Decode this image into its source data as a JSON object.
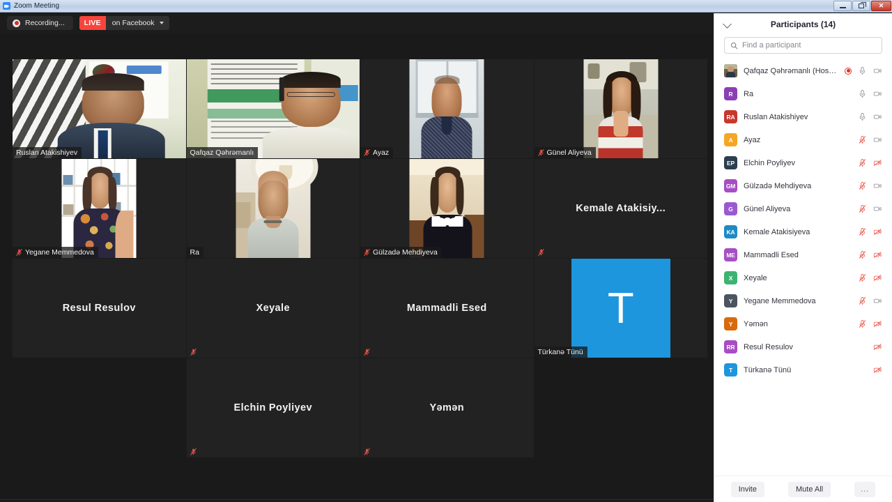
{
  "window": {
    "title": "Zoom Meeting",
    "app_icon": "zoom-camera-icon",
    "minimize_label": "Minimize",
    "restore_label": "Restore",
    "close_label": "Close"
  },
  "toolbar": {
    "recording_label": "Recording...",
    "recording_icon": "record-dot-icon",
    "live_tag": "LIVE",
    "live_destination": "on Facebook",
    "live_caret_icon": "chevron-down-icon"
  },
  "grid": {
    "active_speaker_color": "#c7e035",
    "tile_bg": "#222222",
    "tiles": [
      {
        "name": "Ruslan Atakishiyev",
        "mode": "video",
        "muted": false,
        "active": false,
        "name_position": "bottom-left",
        "feed": "blinds-office",
        "row": 0,
        "col": 0
      },
      {
        "name": "Qafqaz Qəhrəmanlı",
        "mode": "video",
        "muted": false,
        "active": true,
        "name_position": "bottom-left",
        "feed": "banner-headset",
        "row": 0,
        "col": 1
      },
      {
        "name": "Ayaz",
        "mode": "video",
        "muted": true,
        "active": false,
        "name_position": "bottom-left",
        "feed": "window-man",
        "row": 0,
        "col": 2
      },
      {
        "name": "Günel Aliyeva",
        "mode": "video",
        "muted": true,
        "active": false,
        "name_position": "bottom-left",
        "feed": "kitchen-woman",
        "row": 0,
        "col": 3
      },
      {
        "name": "Yegane Memmedova",
        "mode": "video",
        "muted": true,
        "active": false,
        "name_position": "bottom-left",
        "feed": "bookshelf-woman",
        "row": 1,
        "col": 0
      },
      {
        "name": "Ra",
        "mode": "video",
        "muted": false,
        "active": false,
        "name_position": "bottom-left",
        "feed": "ceiling-man",
        "row": 1,
        "col": 1
      },
      {
        "name": "Gülzadə Mehdiyeva",
        "mode": "video",
        "muted": true,
        "active": false,
        "name_position": "bottom-left",
        "feed": "room-woman",
        "row": 1,
        "col": 2
      },
      {
        "name": "Kemale Atakisiy...",
        "mode": "name",
        "muted": true,
        "active": false,
        "name_position": "center",
        "row": 1,
        "col": 3
      },
      {
        "name": "Resul Resulov",
        "mode": "name",
        "muted": false,
        "active": false,
        "name_position": "center",
        "row": 2,
        "col": 0
      },
      {
        "name": "Xeyale",
        "mode": "name",
        "muted": true,
        "active": false,
        "name_position": "center",
        "row": 2,
        "col": 1
      },
      {
        "name": "Mammadli Esed",
        "mode": "name",
        "muted": true,
        "active": false,
        "name_position": "center",
        "row": 2,
        "col": 2
      },
      {
        "name": "Türkanə Tünü",
        "mode": "avatar",
        "avatar_letter": "T",
        "avatar_color": "#1d96dd",
        "muted": false,
        "active": false,
        "name_position": "bottom-left",
        "row": 2,
        "col": 3
      },
      {
        "name": "Elchin Poyliyev",
        "mode": "name",
        "muted": true,
        "active": false,
        "name_position": "center",
        "row": 3,
        "col": 1
      },
      {
        "name": "Yəmən",
        "mode": "name",
        "muted": true,
        "active": false,
        "name_position": "center",
        "row": 3,
        "col": 2
      }
    ]
  },
  "panel": {
    "collapse_icon": "chevron-down-icon",
    "title": "Participants (14)",
    "search": {
      "icon": "search-icon",
      "placeholder": "Find a participant",
      "value": ""
    },
    "participants": [
      {
        "name": "Qafqaz Qəhrəmanlı (Host, me)",
        "initials": "",
        "avatar_type": "photo",
        "color": "#4a4236",
        "recording": true,
        "mic": "on",
        "video": "on"
      },
      {
        "name": "Ra",
        "initials": "R",
        "avatar_type": "initials",
        "color": "#8b3fb5",
        "recording": false,
        "mic": "on",
        "video": "on"
      },
      {
        "name": "Ruslan Atakishiyev",
        "initials": "RA",
        "avatar_type": "initials",
        "color": "#c8372d",
        "recording": false,
        "mic": "on",
        "video": "on"
      },
      {
        "name": "Ayaz",
        "initials": "A",
        "avatar_type": "initials",
        "color": "#f5a623",
        "recording": false,
        "mic": "off",
        "video": "on"
      },
      {
        "name": "Elchin Poyliyev",
        "initials": "EP",
        "avatar_type": "initials",
        "color": "#2c3e50",
        "recording": false,
        "mic": "off",
        "video": "off"
      },
      {
        "name": "Gülzadə Mehdiyeva",
        "initials": "GM",
        "avatar_type": "initials",
        "color": "#a64ec4",
        "recording": false,
        "mic": "off",
        "video": "on"
      },
      {
        "name": "Günel Aliyeva",
        "initials": "G",
        "avatar_type": "initials",
        "color": "#9b59d0",
        "recording": false,
        "mic": "off",
        "video": "on"
      },
      {
        "name": "Kemale Atakisiyeva",
        "initials": "KA",
        "avatar_type": "initials",
        "color": "#1e8bc3",
        "recording": false,
        "mic": "off",
        "video": "off"
      },
      {
        "name": "Mammadli Esed",
        "initials": "ME",
        "avatar_type": "initials",
        "color": "#a64ec4",
        "recording": false,
        "mic": "off",
        "video": "off"
      },
      {
        "name": "Xeyale",
        "initials": "X",
        "avatar_type": "initials",
        "color": "#3cb371",
        "recording": false,
        "mic": "off",
        "video": "off"
      },
      {
        "name": "Yegane Memmedova",
        "initials": "Y",
        "avatar_type": "initials",
        "color": "#4a5560",
        "recording": false,
        "mic": "off",
        "video": "on"
      },
      {
        "name": "Yəmən",
        "initials": "Y",
        "avatar_type": "initials",
        "color": "#d9690a",
        "recording": false,
        "mic": "off",
        "video": "off"
      },
      {
        "name": "Resul Resulov",
        "initials": "RR",
        "avatar_type": "initials",
        "color": "#a64ec4",
        "recording": false,
        "mic": "none",
        "video": "off"
      },
      {
        "name": "Türkanə Tünü",
        "initials": "T",
        "avatar_type": "initials",
        "color": "#1d96dd",
        "recording": false,
        "mic": "none",
        "video": "off"
      }
    ],
    "footer": {
      "invite_label": "Invite",
      "mute_all_label": "Mute All",
      "more_label": "..."
    }
  }
}
